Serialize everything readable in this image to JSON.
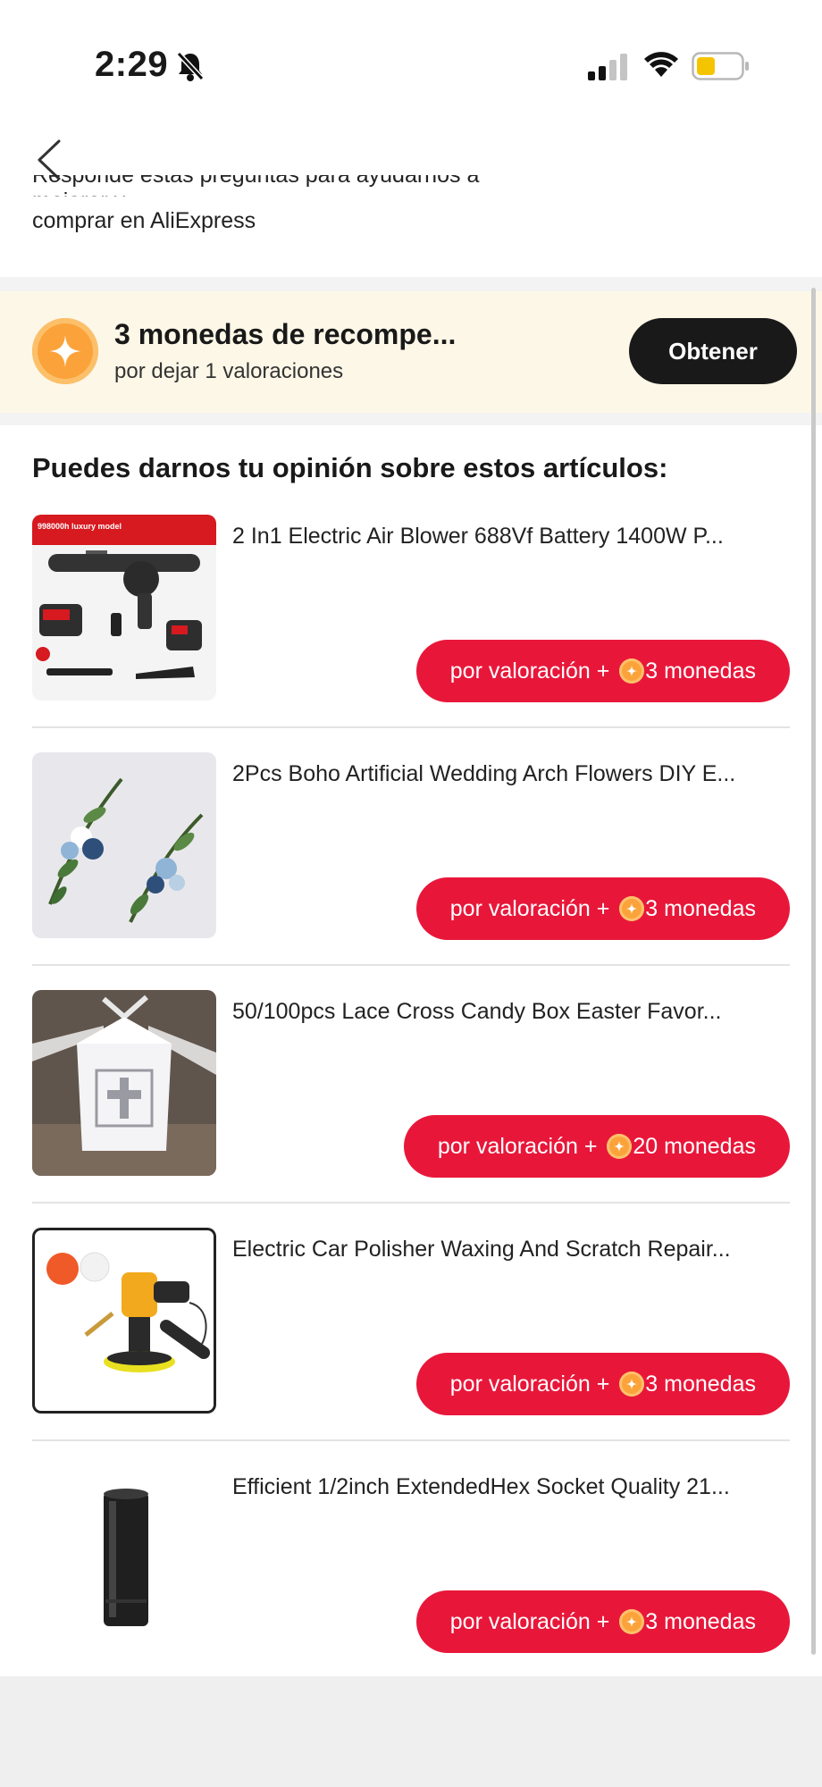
{
  "status": {
    "time": "2:29"
  },
  "intro": {
    "partial_line": "Responde estas preguntas para ayudarnos a mejorar y",
    "text": "comprar en AliExpress"
  },
  "banner": {
    "title": "3 monedas de recompe...",
    "subtitle": "por dejar 1 valoraciones",
    "button": "Obtener"
  },
  "section_title": "Puedes darnos tu opinión sobre estos artículos:",
  "items": [
    {
      "name": "2 In1 Electric Air Blower 688Vf Battery 1400W P...",
      "btn_prefix": "por valoración +",
      "btn_suffix": "3 monedas",
      "thumb_label": "998000h luxury model"
    },
    {
      "name": "2Pcs Boho Artificial Wedding Arch Flowers DIY E...",
      "btn_prefix": "por valoración +",
      "btn_suffix": "3 monedas"
    },
    {
      "name": "50/100pcs Lace Cross Candy Box Easter Favor...",
      "btn_prefix": "por valoración +",
      "btn_suffix": "20 monedas"
    },
    {
      "name": "Electric Car Polisher Waxing And Scratch Repair...",
      "btn_prefix": "por valoración +",
      "btn_suffix": "3 monedas"
    },
    {
      "name": "Efficient 1/2inch ExtendedHex Socket Quality 21...",
      "btn_prefix": "por valoración +",
      "btn_suffix": "3 monedas"
    }
  ],
  "colors": {
    "accent_red": "#e8173a",
    "coin": "#fba33a",
    "banner_bg": "#fdf7e7"
  }
}
